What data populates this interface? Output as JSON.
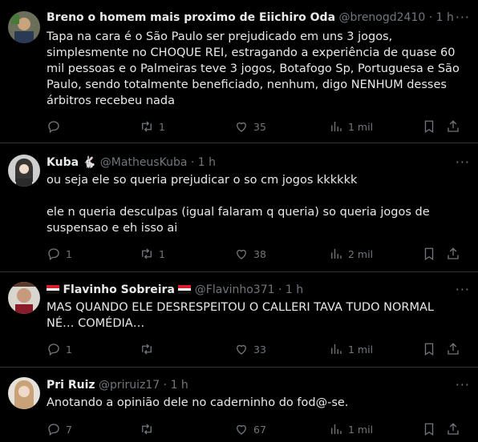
{
  "tweets": [
    {
      "name": "Breno o homem mais proximo de Eiichiro Oda",
      "handle": "@brenogd2410",
      "time": "· 1 h",
      "text": "Tapa na cara é o São Paulo ser prejudicado em uns 3 jogos, simplesmente no CHOQUE REI, estragando a experiência de quase 60 mil pessoas e o Palmeiras teve 3 jogos, Botafogo Sp, Portuguesa e São Paulo, sendo totalmente beneficiado, nenhum, digo NENHUM desses árbitros recebeu nada",
      "replies": "",
      "retweets": "1",
      "likes": "35",
      "views": "1 mil"
    },
    {
      "name": "Kuba 🐇",
      "handle": "@MatheusKuba",
      "time": "· 1 h",
      "text": "ou seja ele so queria prejudicar o so cm jogos kkkkkk\n\nele n queria desculpas (igual falaram q queria) so queria jogos de suspensao e eh isso ai",
      "replies": "1",
      "retweets": "1",
      "likes": "38",
      "views": "2 mil"
    },
    {
      "name": "Flavinho Sobreira",
      "handle": "@Flavinho371",
      "time": "· 1 h",
      "text": "MAS QUANDO ELE DESRESPEITOU O CALLERI TAVA TUDO NORMAL NÉ… COMÉDIA…",
      "replies": "1",
      "retweets": "",
      "likes": "33",
      "views": "1 mil"
    },
    {
      "name": "Pri Ruiz",
      "handle": "@priruiz17",
      "time": "· 1 h",
      "text": "Anotando a opinião dele no caderninho do fod@-se.",
      "replies": "7",
      "retweets": "",
      "likes": "67",
      "views": "1 mil"
    }
  ],
  "more_label": "···",
  "colors": {
    "background": "#000000",
    "text": "#e7e9ea",
    "muted": "#71767b",
    "divider": "#2f3336"
  },
  "icons": [
    "reply-icon",
    "retweet-icon",
    "like-icon",
    "views-icon",
    "bookmark-icon",
    "share-icon",
    "more-icon",
    "flag-icon"
  ]
}
